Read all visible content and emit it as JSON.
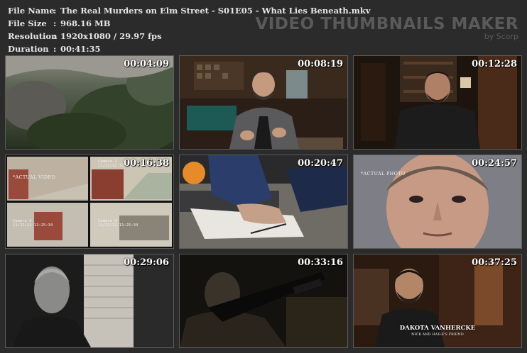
{
  "info": {
    "rows": [
      {
        "key": "File Name",
        "sep": ":",
        "value": "The Real Murders on Elm Street - S01E05 - What Lies Beneath.mkv"
      },
      {
        "key": "File Size",
        "sep": ":",
        "value": "968.16 MB"
      },
      {
        "key": "Resolution",
        "sep": ":",
        "value": "1920x1080 / 29.97 fps"
      },
      {
        "key": "Duration",
        "sep": ":",
        "value": "00:41:35"
      }
    ]
  },
  "brand": {
    "title": "VIDEO THUMBNAILS MAKER",
    "by": "by Scorp"
  },
  "thumbnails": [
    {
      "time": "00:04:09",
      "scene": "aerial-trees"
    },
    {
      "time": "00:08:19",
      "scene": "bearded-man-interview"
    },
    {
      "time": "00:12:28",
      "scene": "man-library-interview"
    },
    {
      "time": "00:16:38",
      "scene": "security-camera-grid",
      "caption": "*ACTUAL VIDEO",
      "cameras": [
        "Camera 1\n11/22/12 11:25:34",
        "Camera 2\n11/22/12 11:25:34",
        "Camera 3\n11/22/12 11:25:34",
        "Camera 4\n11/22/12 11:25:34"
      ]
    },
    {
      "time": "00:20:47",
      "scene": "hands-on-desk"
    },
    {
      "time": "00:24:57",
      "scene": "mugshot-closeup",
      "caption": "*ACTUAL PHOTO"
    },
    {
      "time": "00:29:06",
      "scene": "man-by-window"
    },
    {
      "time": "00:33:16",
      "scene": "rifle-silhouette"
    },
    {
      "time": "00:37:25",
      "scene": "interview-lower-third",
      "name": "DAKOTA VANHERCKE",
      "role": "NICK AND HAILE'S FRIEND"
    }
  ]
}
